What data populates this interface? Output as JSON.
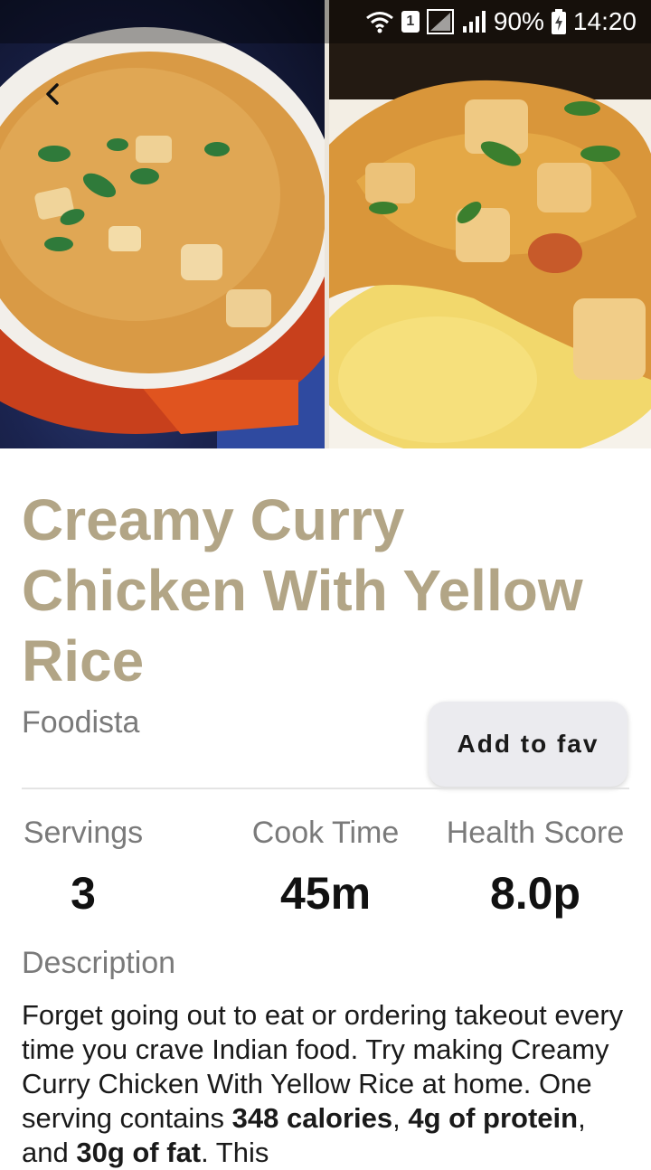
{
  "status_bar": {
    "sim_number": "1",
    "battery_percent": "90%",
    "time": "14:20"
  },
  "hero": {
    "back_icon": "chevron-left-icon"
  },
  "recipe": {
    "title": "Creamy Curry Chicken With Yellow Rice",
    "source": "Foodista",
    "fav_button_label": "Add to fav"
  },
  "stats": {
    "servings_label": "Servings",
    "servings_value": "3",
    "cook_time_label": "Cook Time",
    "cook_time_value": "45m",
    "health_score_label": "Health Score",
    "health_score_value": "8.0p"
  },
  "description": {
    "label": "Description",
    "text_1": "Forget going out to eat or ordering takeout every time you crave Indian food. Try making Creamy Curry Chicken With Yellow Rice at home. One serving contains ",
    "bold_1": "348 calories",
    "text_2": ", ",
    "bold_2": "4g of protein",
    "text_3": ", and ",
    "bold_3": "30g of fat",
    "text_4": ". This"
  },
  "colors": {
    "title": "#b2a586",
    "button_bg": "#ebebef",
    "label_gray": "#7a7a7a"
  }
}
